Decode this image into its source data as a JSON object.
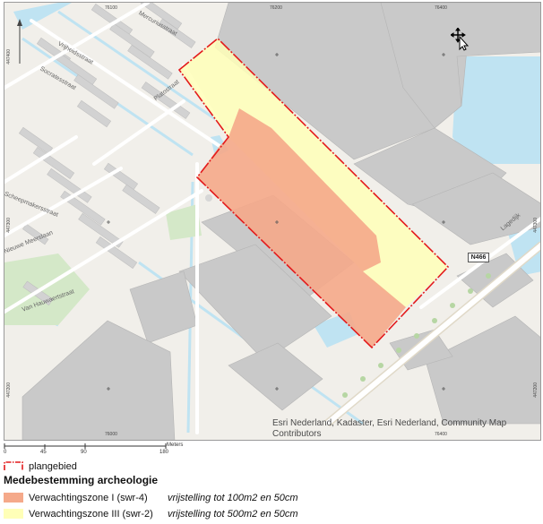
{
  "map": {
    "coords": {
      "top": [
        "76100",
        "76200",
        "76400"
      ],
      "bottom": [
        "76000",
        "76400"
      ],
      "left": [
        "447400",
        "447300",
        "447200"
      ],
      "right": [
        "447300",
        "447200"
      ]
    },
    "streets": [
      "Socratesstraat",
      "Platostraat",
      "Scheepmakersstraat",
      "Mercuriusstraat",
      "Van Hauwaertstraat",
      "Nieuwe Meerslaan",
      "Vrijheidsstraat",
      "Lagedijk"
    ],
    "road_shield": "N466",
    "attribution": "Esri Nederland, Kadaster, Esri Nederland, Community Map Contributors",
    "icons": [
      "north-arrow-icon",
      "move-cursor-icon",
      "pointer-cursor-icon"
    ]
  },
  "scalebar": {
    "ticks": [
      "0",
      "45",
      "90",
      "180"
    ],
    "unit": "Meters"
  },
  "legend": {
    "plangebied_label": "plangebied",
    "heading": "Medebestemming archeologie",
    "items": [
      {
        "label": "Verwachtingszone I (swr-4)",
        "note": "vrijstelling tot 100m2 en 50cm",
        "color": "#f5a98a"
      },
      {
        "label": "Verwachtingszone III (swr-2)",
        "note": "vrijstelling tot 500m2 en 50cm",
        "color": "#ffffb8"
      }
    ],
    "plangebied_color": "#e31a1c"
  }
}
